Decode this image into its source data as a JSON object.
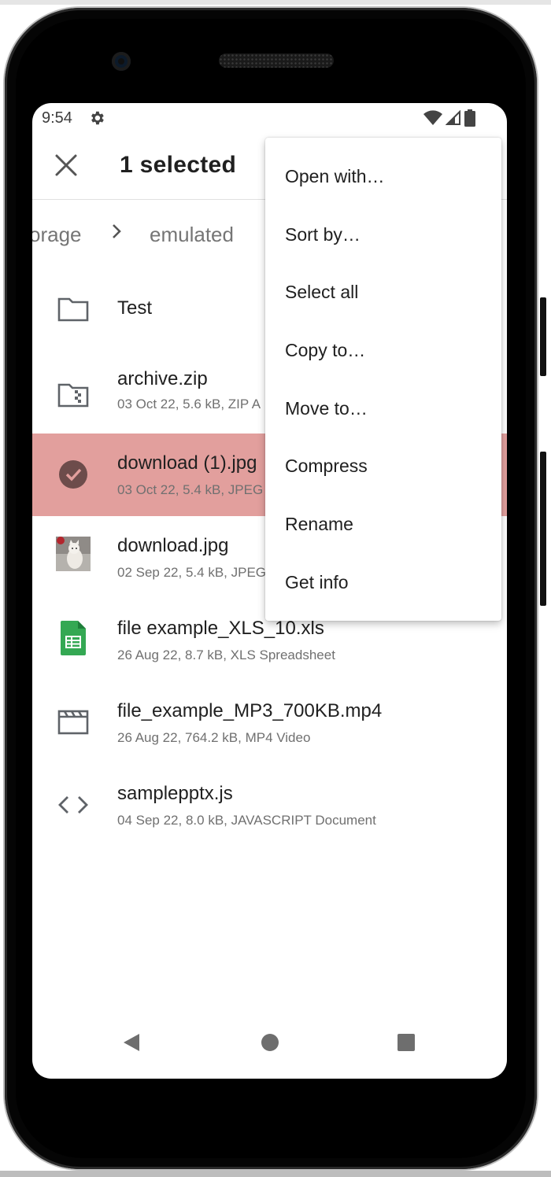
{
  "status_bar": {
    "time": "9:54"
  },
  "app_bar": {
    "title": "1 selected"
  },
  "breadcrumb": {
    "items": [
      "orage",
      "emulated"
    ]
  },
  "files": [
    {
      "name": "Test",
      "meta": "",
      "icon": "folder-icon",
      "selected": false
    },
    {
      "name": "archive.zip",
      "meta": "03 Oct 22, 5.6 kB, ZIP A",
      "icon": "zip-archive-icon",
      "selected": false
    },
    {
      "name": "download (1).jpg",
      "meta": "03 Oct 22, 5.4 kB, JPEG",
      "icon": "check-circle-icon",
      "selected": true
    },
    {
      "name": "download.jpg",
      "meta": "02 Sep 22, 5.4 kB, JPEG",
      "icon": "image-thumbnail",
      "selected": false
    },
    {
      "name": "file example_XLS_10.xls",
      "meta": "26 Aug 22, 8.7 kB, XLS Spreadsheet",
      "icon": "spreadsheet-icon",
      "selected": false
    },
    {
      "name": "file_example_MP3_700KB.mp4",
      "meta": "26 Aug 22, 764.2 kB, MP4 Video",
      "icon": "video-icon",
      "selected": false
    },
    {
      "name": "samplepptx.js",
      "meta": "04 Sep 22, 8.0 kB, JAVASCRIPT Document",
      "icon": "code-icon",
      "selected": false
    }
  ],
  "menu": {
    "items": [
      "Open with…",
      "Sort by…",
      "Select all",
      "Copy to…",
      "Move to…",
      "Compress",
      "Rename",
      "Get info"
    ]
  },
  "colors": {
    "selected_row": "#e29f9d",
    "spreadsheet_green": "#34a853",
    "check_circle": "#6d4c4b"
  }
}
